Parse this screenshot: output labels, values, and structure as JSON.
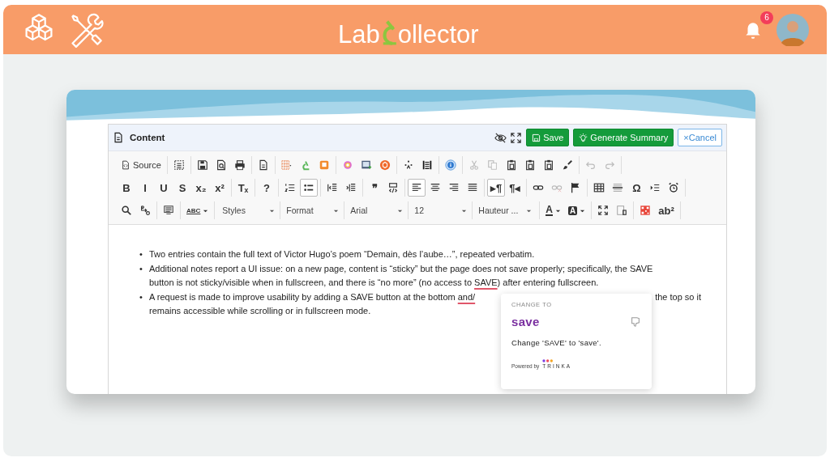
{
  "header": {
    "logo": {
      "before": "Lab",
      "after": "ollector"
    },
    "notifications": {
      "count": "6"
    }
  },
  "editor": {
    "title": "Content",
    "buttons": [
      {
        "kind": "save",
        "label": "Save"
      },
      {
        "kind": "summary",
        "label": "Generate Summary"
      },
      {
        "kind": "cancel",
        "label": "Cancel",
        "icon_text": "×"
      }
    ],
    "toolbar": [
      [
        [
          {
            "kind": "source",
            "text": "Source",
            "selected": false,
            "disabled": false
          }
        ],
        [
          {
            "kind": "selectall",
            "selected": false,
            "disabled": false
          }
        ],
        [
          {
            "kind": "save",
            "selected": false,
            "disabled": false
          },
          {
            "kind": "preview",
            "selected": false,
            "disabled": false
          },
          {
            "kind": "print",
            "selected": false,
            "disabled": false
          }
        ],
        [
          {
            "kind": "template",
            "selected": false,
            "disabled": false
          }
        ],
        [
          {
            "kind": "tablegrid",
            "selected": false,
            "disabled": false
          },
          {
            "kind": "microscope",
            "selected": false,
            "disabled": false
          },
          {
            "kind": "square",
            "selected": false,
            "disabled": false
          }
        ],
        [
          {
            "kind": "colorwheel",
            "selected": false,
            "disabled": false
          },
          {
            "kind": "image",
            "selected": false,
            "disabled": false
          },
          {
            "kind": "badge",
            "selected": false,
            "disabled": false
          }
        ],
        [
          {
            "kind": "dots",
            "selected": false,
            "disabled": false
          },
          {
            "kind": "pagebreak",
            "selected": false,
            "disabled": false
          }
        ],
        [
          {
            "kind": "info",
            "selected": false,
            "disabled": false
          }
        ],
        [
          {
            "kind": "cut",
            "selected": false,
            "disabled": true
          },
          {
            "kind": "copy",
            "selected": false,
            "disabled": true
          },
          {
            "kind": "paste",
            "selected": false,
            "disabled": false
          },
          {
            "kind": "paste",
            "selected": false,
            "disabled": false
          },
          {
            "kind": "paste",
            "selected": false,
            "disabled": false
          },
          {
            "kind": "brush",
            "selected": false,
            "disabled": false
          }
        ],
        [
          {
            "kind": "undo",
            "selected": false,
            "disabled": true
          },
          {
            "kind": "redo",
            "selected": false,
            "disabled": true
          }
        ]
      ],
      [
        [
          {
            "kind": "glyph",
            "text": "B",
            "selected": false,
            "disabled": false
          },
          {
            "kind": "glyph",
            "text": "I",
            "selected": false,
            "disabled": false
          },
          {
            "kind": "glyph",
            "text": "U",
            "selected": false,
            "disabled": false
          },
          {
            "kind": "glyph",
            "text": "S",
            "selected": false,
            "disabled": false
          },
          {
            "kind": "glyph",
            "text": "x₂",
            "selected": false,
            "disabled": false
          },
          {
            "kind": "glyph",
            "text": "x²",
            "selected": false,
            "disabled": false
          }
        ],
        [
          {
            "kind": "glyph",
            "text": "Tₓ",
            "selected": false,
            "disabled": false
          }
        ],
        [
          {
            "kind": "glyph",
            "text": "?",
            "selected": false,
            "disabled": false
          }
        ],
        [
          {
            "kind": "numbered",
            "selected": false,
            "disabled": false
          },
          {
            "kind": "bulleted",
            "selected": true,
            "disabled": false
          }
        ],
        [
          {
            "kind": "outdent",
            "selected": false,
            "disabled": false
          },
          {
            "kind": "indent",
            "selected": false,
            "disabled": false
          }
        ],
        [
          {
            "kind": "glyph",
            "text": "❞",
            "selected": false,
            "disabled": false
          },
          {
            "kind": "div",
            "selected": false,
            "disabled": false
          }
        ],
        [
          {
            "kind": "alignleft",
            "selected": true,
            "disabled": false
          },
          {
            "kind": "aligncenter",
            "selected": false,
            "disabled": false
          },
          {
            "kind": "alignright",
            "selected": false,
            "disabled": false
          },
          {
            "kind": "justify",
            "selected": false,
            "disabled": false
          }
        ],
        [
          {
            "kind": "glyph",
            "text": "▸¶",
            "selected": true,
            "disabled": false
          },
          {
            "kind": "glyph",
            "text": "¶◂",
            "selected": false,
            "disabled": false
          }
        ],
        [
          {
            "kind": "link",
            "selected": false,
            "disabled": false
          },
          {
            "kind": "unlink",
            "selected": false,
            "disabled": true
          },
          {
            "kind": "flag",
            "selected": false,
            "disabled": false
          }
        ],
        [
          {
            "kind": "table",
            "selected": false,
            "disabled": false
          },
          {
            "kind": "rule",
            "selected": false,
            "disabled": false
          },
          {
            "kind": "glyph",
            "text": "Ω",
            "selected": false,
            "disabled": false
          },
          {
            "kind": "listindent",
            "selected": false,
            "disabled": false
          },
          {
            "kind": "alarm",
            "selected": false,
            "disabled": false
          }
        ]
      ],
      [
        [
          {
            "kind": "search",
            "selected": false,
            "disabled": false
          },
          {
            "kind": "replace",
            "selected": false,
            "disabled": false
          }
        ],
        [
          {
            "kind": "paraformat",
            "selected": false,
            "disabled": false
          }
        ],
        [
          {
            "kind": "spellcheck",
            "text": "ABC",
            "selected": false,
            "disabled": false
          }
        ],
        [
          {
            "kind": "combo",
            "text": "Styles"
          },
          {
            "kind": "combo",
            "text": "Format"
          },
          {
            "kind": "combo",
            "text": "Arial"
          },
          {
            "kind": "combo",
            "text": "12"
          },
          {
            "kind": "combo",
            "text": "Hauteur ..."
          }
        ],
        [
          {
            "kind": "textcolor",
            "text": "A",
            "selected": false,
            "disabled": false
          },
          {
            "kind": "bgcolor",
            "text": "A",
            "selected": false,
            "disabled": false
          }
        ],
        [
          {
            "kind": "maximize",
            "selected": false,
            "disabled": false
          },
          {
            "kind": "showblocks",
            "selected": false,
            "disabled": false
          }
        ],
        [
          {
            "kind": "qrcode",
            "selected": false,
            "disabled": false
          },
          {
            "kind": "glyph",
            "text": "ab²",
            "selected": false,
            "disabled": false
          }
        ]
      ]
    ],
    "bullets": [
      {
        "marker": "•",
        "lines": [
          [
            {
              "text": "Two entries contain the full text of Victor Hugo’s poem “Demain, dès l’aube…”, repeated verbatim.",
              "flagged": false
            }
          ]
        ]
      },
      {
        "marker": "•",
        "lines": [
          [
            {
              "text": "Additional notes report a UI issue: on a new page, content is “sticky” but the page does not save properly; specifically, the SAVE",
              "flagged": false
            }
          ],
          [
            {
              "text": "button is not sticky/visible when in fullscreen, and there is “no more” (no access to ",
              "flagged": false
            },
            {
              "text": "SAVE",
              "flagged": true
            },
            {
              "text": ") after entering fullscreen.",
              "flagged": false
            }
          ]
        ]
      },
      {
        "marker": "•",
        "lines": [
          [
            {
              "text": "A request is made to improve usability by adding a SAVE button at the bottom ",
              "flagged": false
            },
            {
              "text": "and/",
              "flagged": true
            },
            {
              "kind": "gap"
            },
            {
              "text": "the top so it",
              "flagged": false
            }
          ],
          [
            {
              "text": "remains accessible while scrolling or in fullscreen mode.",
              "flagged": false
            }
          ]
        ]
      }
    ],
    "suggestion": {
      "heading": "CHANGE TO",
      "replacement": "save",
      "message": "Change 'SAVE' to 'save'.",
      "powered_by": "Powered by",
      "brand": "TRINKA"
    }
  }
}
